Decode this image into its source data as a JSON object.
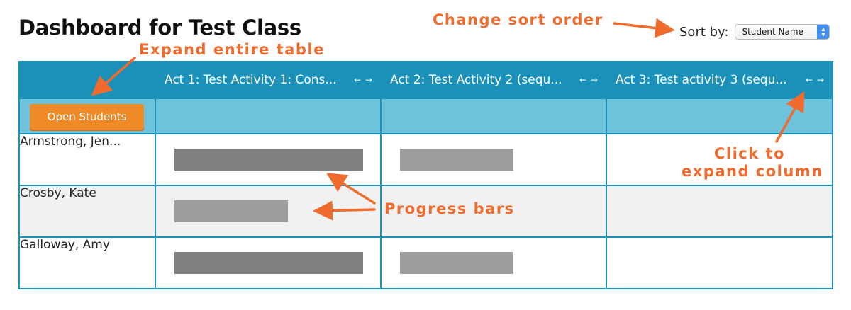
{
  "title": "Dashboard for Test Class",
  "sort": {
    "label": "Sort by:",
    "value": "Student Name"
  },
  "table": {
    "columns": [
      {
        "label": "Act 1: Test Activity 1: Cons...",
        "arrows": "← →"
      },
      {
        "label": "Act 2: Test Activity 2 (sequ...",
        "arrows": "← →"
      },
      {
        "label": "Act 3: Test activity 3 (sequ...",
        "arrows": "← →"
      }
    ],
    "open_students_label": "Open Students",
    "students": [
      {
        "name": "Armstrong, Jen...",
        "progress": [
          1.0,
          0.6,
          0
        ]
      },
      {
        "name": "Crosby, Kate",
        "progress": [
          0.6,
          0,
          0
        ]
      },
      {
        "name": "Galloway, Amy",
        "progress": [
          1.0,
          0.6,
          0
        ]
      }
    ]
  },
  "annotations": {
    "change_sort": "Change sort order",
    "expand_table": "Expand entire table",
    "expand_column_line1": "Click to",
    "expand_column_line2": "expand column",
    "progress_bars": "Progress bars"
  },
  "colors": {
    "header": "#1b90b8",
    "subheader": "#6cc3db",
    "button": "#ef8a26",
    "annotation": "#ef6b2e",
    "bar_complete": "#808080",
    "bar_partial": "#9d9d9d"
  }
}
